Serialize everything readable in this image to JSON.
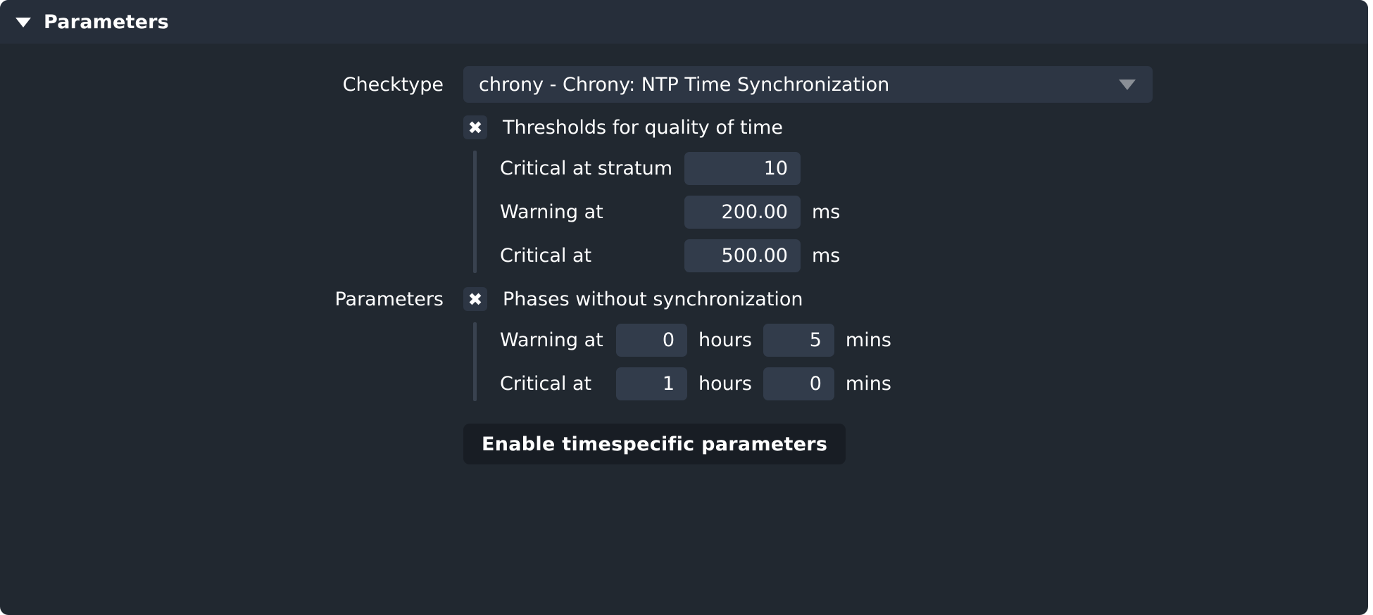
{
  "panel": {
    "title": "Parameters",
    "disclosure_icon": "triangle-down-icon",
    "expanded": true
  },
  "colors": {
    "panel_background": "#212830",
    "header_background": "#262e3a",
    "field_background": "#323c4b",
    "select_background": "#2d3644",
    "button_background": "#181d24",
    "text": "#ffffff",
    "arrow": "#8a8f96",
    "rule": "#39424f"
  },
  "checktype": {
    "label": "Checktype",
    "value": "chrony - Chrony: NTP Time Synchronization",
    "arrow_icon": "chevron-down-icon"
  },
  "parameters": {
    "label": "Parameters",
    "groups": [
      {
        "checkbox_label": "Thresholds for quality of time",
        "checkbox_checked": true,
        "checkbox_icon": "checkmark-x-icon",
        "fields": [
          {
            "label": "Critical at stratum",
            "value": "10",
            "unit": ""
          },
          {
            "label": "Warning at",
            "value": "200.00",
            "unit": "ms"
          },
          {
            "label": "Critical at",
            "value": "500.00",
            "unit": "ms"
          }
        ]
      },
      {
        "checkbox_label": "Phases without synchronization",
        "checkbox_checked": true,
        "checkbox_icon": "checkmark-x-icon",
        "fields": [
          {
            "label": "Warning at",
            "value_hours": "0",
            "unit_hours": "hours",
            "value_mins": "5",
            "unit_mins": "mins"
          },
          {
            "label": "Critical at",
            "value_hours": "1",
            "unit_hours": "hours",
            "value_mins": "0",
            "unit_mins": "mins"
          }
        ]
      }
    ]
  },
  "button": {
    "label": "Enable timespecific parameters"
  }
}
